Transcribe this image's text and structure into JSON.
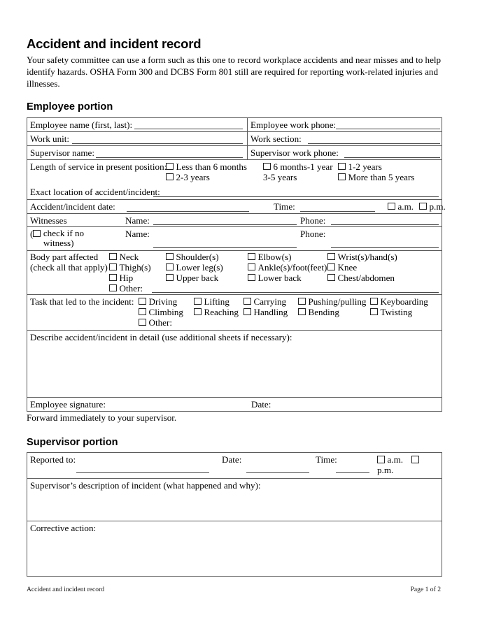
{
  "document": {
    "title": "Accident and incident record",
    "intro": "Your safety committee can use a form such as this one to record workplace accidents and near misses and to help identify hazards. OSHA Form 300 and DCBS Form 801 still are required for reporting work-related injuries and illnesses.",
    "forward_note": "Forward immediately to your supervisor."
  },
  "footer": {
    "left": "Accident and incident record",
    "right": "Page 1 of 2"
  },
  "employee_section": {
    "heading": "Employee portion",
    "fields": {
      "employee_name": "Employee name (first, last):",
      "employee_work_phone": "Employee work phone:",
      "work_unit": "Work unit:",
      "work_section": "Work section:",
      "supervisor_name": "Supervisor name:",
      "supervisor_work_phone": "Supervisor work phone:",
      "length_of_service": "Length of service in present position:",
      "exact_location": "Exact location of accident/incident:",
      "accident_date": "Accident/incident date:",
      "time": "Time:",
      "am": "a.m.",
      "pm": "p.m.",
      "witnesses": "Witnesses",
      "no_witness_note": "check if no witness)",
      "name": "Name:",
      "phone": "Phone:",
      "body_part_affected": "Body part affected",
      "check_all_that_apply": "(check all that apply)",
      "task_led_to_incident": "Task that led to the incident:",
      "other": "Other:",
      "describe": "Describe accident/incident in detail (use additional sheets if necessary):",
      "employee_signature": "Employee signature:",
      "date": "Date:"
    },
    "length_of_service_options": [
      "Less than 6 months",
      "6 months-1 year",
      "1-2 years",
      "2-3 years",
      "3-5 years",
      "More than 5 years"
    ],
    "body_parts": [
      "Neck",
      "Shoulder(s)",
      "Elbow(s)",
      "Wrist(s)/hand(s)",
      "Thigh(s)",
      "Lower leg(s)",
      "Ankle(s)/foot(feet)",
      "Knee",
      "Hip",
      "Upper back",
      "Lower back",
      "Chest/abdomen"
    ],
    "tasks": [
      "Driving",
      "Lifting",
      "Carrying",
      "Pushing/pulling",
      "Keyboarding",
      "Climbing",
      "Reaching",
      "Handling",
      "Bending",
      "Twisting"
    ]
  },
  "supervisor_section": {
    "heading": "Supervisor portion",
    "fields": {
      "reported_to": "Reported to:",
      "date": "Date:",
      "time": "Time:",
      "am": "a.m.",
      "pm": "p.m.",
      "description": "Supervisor’s description of incident (what happened and why):",
      "corrective_action": "Corrective action:"
    }
  }
}
